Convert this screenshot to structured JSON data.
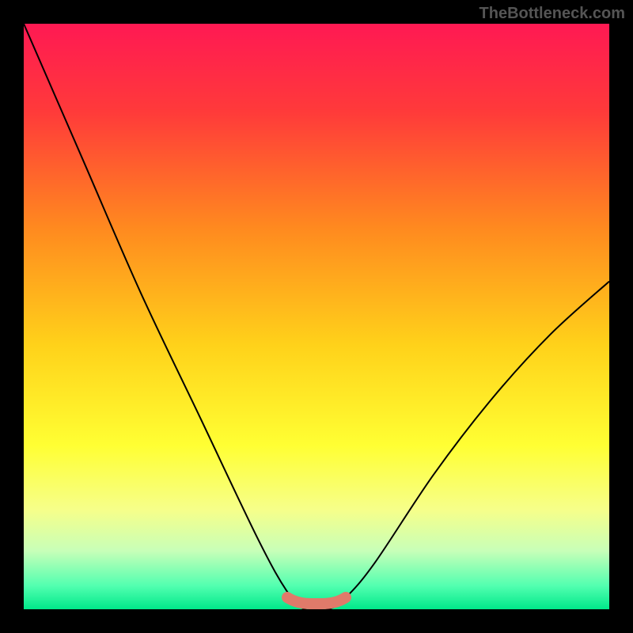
{
  "watermark": "TheBottleneck.com",
  "gradient": {
    "stops": [
      {
        "offset": 0.0,
        "color": "#ff1953"
      },
      {
        "offset": 0.15,
        "color": "#ff3a3a"
      },
      {
        "offset": 0.35,
        "color": "#ff8a1f"
      },
      {
        "offset": 0.55,
        "color": "#ffd21a"
      },
      {
        "offset": 0.72,
        "color": "#ffff33"
      },
      {
        "offset": 0.83,
        "color": "#f6ff8a"
      },
      {
        "offset": 0.9,
        "color": "#c8ffb8"
      },
      {
        "offset": 0.96,
        "color": "#52ffb0"
      },
      {
        "offset": 1.0,
        "color": "#00e88a"
      }
    ]
  },
  "chart_data": {
    "type": "line",
    "title": "",
    "xlabel": "",
    "ylabel": "",
    "xlim": [
      0,
      100
    ],
    "ylim": [
      0,
      100
    ],
    "categories": [
      0,
      10,
      20,
      30,
      40,
      45,
      48,
      52,
      55,
      60,
      70,
      80,
      90,
      100
    ],
    "series": [
      {
        "name": "bottleneck-curve",
        "x": [
          0,
          10,
          20,
          30,
          40,
          45,
          48,
          52,
          55,
          60,
          70,
          80,
          90,
          100
        ],
        "values": [
          100,
          77,
          54,
          33,
          12,
          3,
          0,
          0,
          2,
          8,
          23,
          36,
          47,
          56
        ]
      }
    ],
    "highlight": {
      "name": "minimum-plateau",
      "x_range": [
        45,
        55
      ],
      "y": 0,
      "color": "#e07a6a"
    }
  }
}
